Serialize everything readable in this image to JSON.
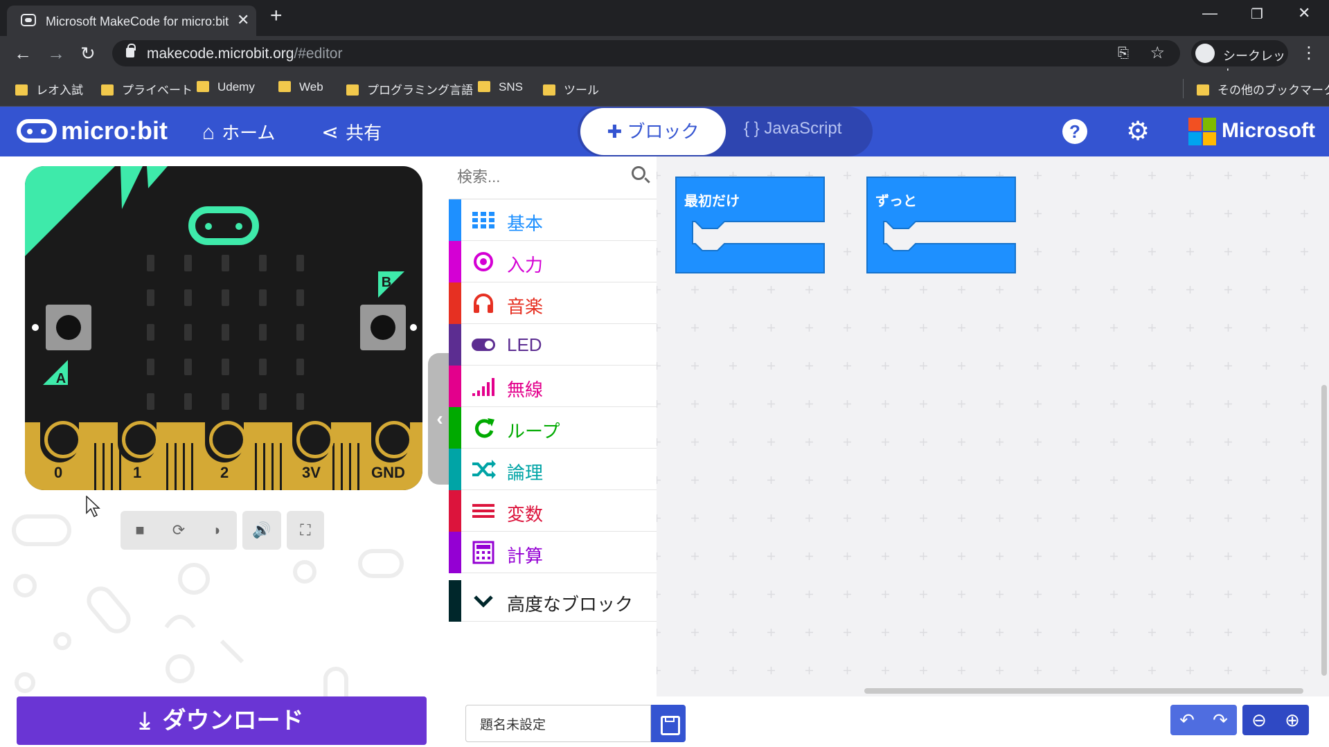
{
  "browser": {
    "tab_title": "Microsoft MakeCode for micro:bit",
    "tab_close": "✕",
    "new_tab": "+",
    "url_host": "makecode.microbit.org",
    "url_path": "/#editor",
    "profile_label": "シークレット",
    "bookmarks": [
      "レオ入試",
      "プライベート",
      "Udemy",
      "Web",
      "プログラミング言語",
      "SNS",
      "ツール"
    ],
    "other_bookmarks": "その他のブックマーク"
  },
  "header": {
    "logo": "micro:bit",
    "home": "ホーム",
    "share": "共有",
    "mode_blocks": "ブロック",
    "mode_js": "JavaScript",
    "brand": "Microsoft"
  },
  "simulator": {
    "pins": [
      "0",
      "1",
      "2",
      "3V",
      "GND"
    ],
    "button_a": "A",
    "button_b": "B"
  },
  "toolbox": {
    "search_placeholder": "検索...",
    "categories": [
      {
        "label": "基本",
        "color": "#1e90ff",
        "icon": "grid-icon"
      },
      {
        "label": "入力",
        "color": "#d400d4",
        "icon": "target-icon"
      },
      {
        "label": "音楽",
        "color": "#e63022",
        "icon": "headphones-icon"
      },
      {
        "label": "LED",
        "color": "#5c2d91",
        "icon": "toggle-icon"
      },
      {
        "label": "無線",
        "color": "#e3008c",
        "icon": "signal-icon"
      },
      {
        "label": "ループ",
        "color": "#00aa00",
        "icon": "refresh-icon"
      },
      {
        "label": "論理",
        "color": "#00a4a6",
        "icon": "shuffle-icon"
      },
      {
        "label": "変数",
        "color": "#dc143c",
        "icon": "lines-icon"
      },
      {
        "label": "計算",
        "color": "#9400d3",
        "icon": "calculator-icon"
      }
    ],
    "advanced": {
      "label": "高度なブロック",
      "color": "#00272b"
    }
  },
  "workspace": {
    "blocks": [
      {
        "label": "最初だけ",
        "color": "#1e90ff"
      },
      {
        "label": "ずっと",
        "color": "#1e90ff"
      }
    ]
  },
  "footer": {
    "download": "ダウンロード",
    "project_name": "題名未設定"
  },
  "colors": {
    "header_blue": "#3454d1",
    "download_purple": "#6a35d4",
    "board_gold": "#d4a935",
    "board_accent": "#3eeaaa"
  }
}
